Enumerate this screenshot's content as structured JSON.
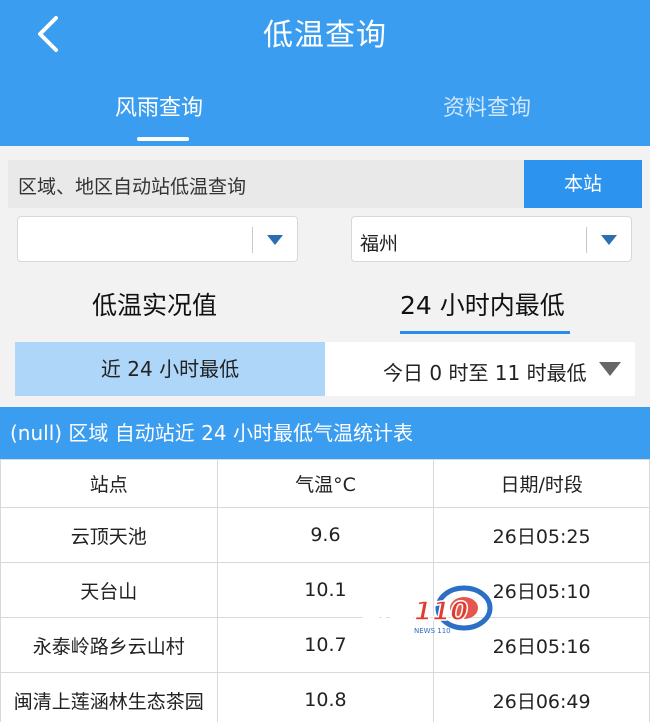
{
  "header": {
    "title": "低温查询",
    "tabs": [
      {
        "label": "风雨查询"
      },
      {
        "label": "资料查询"
      }
    ]
  },
  "query": {
    "label": "区域、地区自动站低温查询",
    "local_button": "本站"
  },
  "selects": [
    {
      "value": ""
    },
    {
      "value": "福州"
    }
  ],
  "modes": [
    {
      "label": "低温实况值"
    },
    {
      "label": "24 小时内最低"
    }
  ],
  "range": {
    "active": "近 24 小时最低",
    "other": "今日 0 时至 11 时最低"
  },
  "table": {
    "title": "(null) 区域 自动站近 24 小时最低气温统计表",
    "headers": [
      "站点",
      "气温°C",
      "日期/时段"
    ],
    "rows": [
      [
        "云顶天池",
        "9.6",
        "26日05:25"
      ],
      [
        "天台山",
        "10.1",
        "26日05:10"
      ],
      [
        "永泰岭路乡云山村",
        "10.7",
        "26日05:16"
      ],
      [
        "闽清上莲涵林生态茶园",
        "10.8",
        "26日06:49"
      ]
    ]
  },
  "watermark": {
    "text": "新闻110",
    "sub": "NEWS 110"
  },
  "colors": {
    "primary": "#3a9df0",
    "button": "#2c93ee",
    "active_tab_bg": "#aed6f8"
  }
}
